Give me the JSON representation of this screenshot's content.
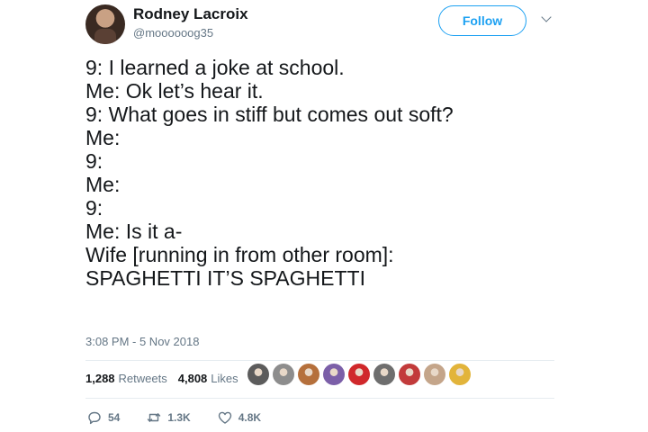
{
  "author": {
    "name": "Rodney Lacroix",
    "handle": "@moooooog35"
  },
  "follow_label": "Follow",
  "tweet_lines": [
    "9: I learned a joke at school.",
    "Me: Ok let’s hear it.",
    "9: What goes in stiff but comes out soft?",
    "Me:",
    "9:",
    "Me:",
    "9:",
    "Me: Is it a-",
    "Wife [running in from other room]:",
    "SPAGHETTI IT’S SPAGHETTI"
  ],
  "timestamp": "3:08 PM - 5 Nov 2018",
  "stats": {
    "retweets_count": "1,288",
    "retweets_label": "Retweets",
    "likes_count": "4,808",
    "likes_label": "Likes"
  },
  "liker_avatars": [
    {
      "name": "liker-avatar-1",
      "color": "#5c5c5c"
    },
    {
      "name": "liker-avatar-2",
      "color": "#8d8d8d"
    },
    {
      "name": "liker-avatar-3",
      "color": "#b5703c"
    },
    {
      "name": "liker-avatar-4",
      "color": "#7b5fa8"
    },
    {
      "name": "liker-avatar-5",
      "color": "#d0282b"
    },
    {
      "name": "liker-avatar-6",
      "color": "#6e6e6e"
    },
    {
      "name": "liker-avatar-7",
      "color": "#c23b3b"
    },
    {
      "name": "liker-avatar-8",
      "color": "#c4a58a"
    },
    {
      "name": "liker-avatar-9",
      "color": "#e2b43b"
    }
  ],
  "actions": {
    "reply_count": "54",
    "retweet_count": "1.3K",
    "like_count": "4.8K"
  },
  "colors": {
    "accent": "#1da1f2",
    "text": "#14171a",
    "secondary": "#657786",
    "divider": "#e6ecf0"
  }
}
